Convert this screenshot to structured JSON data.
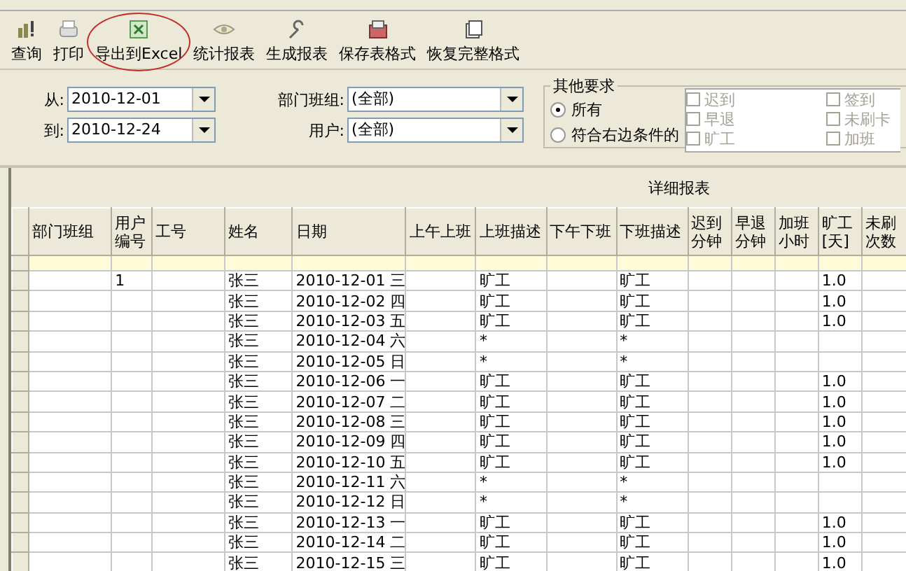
{
  "toolbar": [
    {
      "label": "查询",
      "circled": false
    },
    {
      "label": "打印",
      "circled": false
    },
    {
      "label": "导出到Excel",
      "circled": true
    },
    {
      "label": "统计报表",
      "circled": false
    },
    {
      "label": "生成报表",
      "circled": false
    },
    {
      "label": "保存表格式",
      "circled": false
    },
    {
      "label": "恢复完整格式",
      "circled": false
    }
  ],
  "filters": {
    "from": {
      "label": "从:",
      "value": "2010-12-01"
    },
    "to": {
      "label": "到:",
      "value": "2010-12-24"
    },
    "dept": {
      "label": "部门班组:",
      "value": "(全部)"
    },
    "user": {
      "label": "用户:",
      "value": "(全部)"
    }
  },
  "other": {
    "title": "其他要求",
    "radios": [
      {
        "label": "所有",
        "selected": true
      },
      {
        "label": "符合右边条件的",
        "selected": false
      }
    ],
    "checkboxes": [
      {
        "label": "迟到",
        "checked": false,
        "disabled": true
      },
      {
        "label": "签到",
        "checked": false,
        "disabled": true
      },
      {
        "label": "早退",
        "checked": false,
        "disabled": true
      },
      {
        "label": "未刷卡",
        "checked": false,
        "disabled": true
      },
      {
        "label": "旷工",
        "checked": false,
        "disabled": true
      },
      {
        "label": "加班",
        "checked": false,
        "disabled": true
      }
    ]
  },
  "report": {
    "title": "详细报表",
    "columns": [
      "部门班组",
      "用户编号",
      "工号",
      "姓名",
      "日期",
      "上午上班",
      "上班描述",
      "下午下班",
      "下班描述",
      "迟到分钟",
      "早退分钟",
      "加班小时",
      "旷工[天]",
      "未刷次数"
    ],
    "rows": [
      [
        null,
        "1",
        null,
        "张三",
        "2010-12-01 三",
        null,
        "旷工",
        null,
        "旷工",
        null,
        null,
        null,
        "1.0",
        null
      ],
      [
        null,
        null,
        null,
        "张三",
        "2010-12-02 四",
        null,
        "旷工",
        null,
        "旷工",
        null,
        null,
        null,
        "1.0",
        null
      ],
      [
        null,
        null,
        null,
        "张三",
        "2010-12-03 五",
        null,
        "旷工",
        null,
        "旷工",
        null,
        null,
        null,
        "1.0",
        null
      ],
      [
        null,
        null,
        null,
        "张三",
        "2010-12-04 六",
        null,
        "*",
        null,
        "*",
        null,
        null,
        null,
        null,
        null
      ],
      [
        null,
        null,
        null,
        "张三",
        "2010-12-05 日",
        null,
        "*",
        null,
        "*",
        null,
        null,
        null,
        null,
        null
      ],
      [
        null,
        null,
        null,
        "张三",
        "2010-12-06 一",
        null,
        "旷工",
        null,
        "旷工",
        null,
        null,
        null,
        "1.0",
        null
      ],
      [
        null,
        null,
        null,
        "张三",
        "2010-12-07 二",
        null,
        "旷工",
        null,
        "旷工",
        null,
        null,
        null,
        "1.0",
        null
      ],
      [
        null,
        null,
        null,
        "张三",
        "2010-12-08 三",
        null,
        "旷工",
        null,
        "旷工",
        null,
        null,
        null,
        "1.0",
        null
      ],
      [
        null,
        null,
        null,
        "张三",
        "2010-12-09 四",
        null,
        "旷工",
        null,
        "旷工",
        null,
        null,
        null,
        "1.0",
        null
      ],
      [
        null,
        null,
        null,
        "张三",
        "2010-12-10 五",
        null,
        "旷工",
        null,
        "旷工",
        null,
        null,
        null,
        "1.0",
        null
      ],
      [
        null,
        null,
        null,
        "张三",
        "2010-12-11 六",
        null,
        "*",
        null,
        "*",
        null,
        null,
        null,
        null,
        null
      ],
      [
        null,
        null,
        null,
        "张三",
        "2010-12-12 日",
        null,
        "*",
        null,
        "*",
        null,
        null,
        null,
        null,
        null
      ],
      [
        null,
        null,
        null,
        "张三",
        "2010-12-13 一",
        null,
        "旷工",
        null,
        "旷工",
        null,
        null,
        null,
        "1.0",
        null
      ],
      [
        null,
        null,
        null,
        "张三",
        "2010-12-14 二",
        null,
        "旷工",
        null,
        "旷工",
        null,
        null,
        null,
        "1.0",
        null
      ],
      [
        null,
        null,
        null,
        "张三",
        "2010-12-15 三",
        null,
        "旷工",
        null,
        "旷工",
        null,
        null,
        null,
        "1.0",
        null
      ]
    ]
  }
}
